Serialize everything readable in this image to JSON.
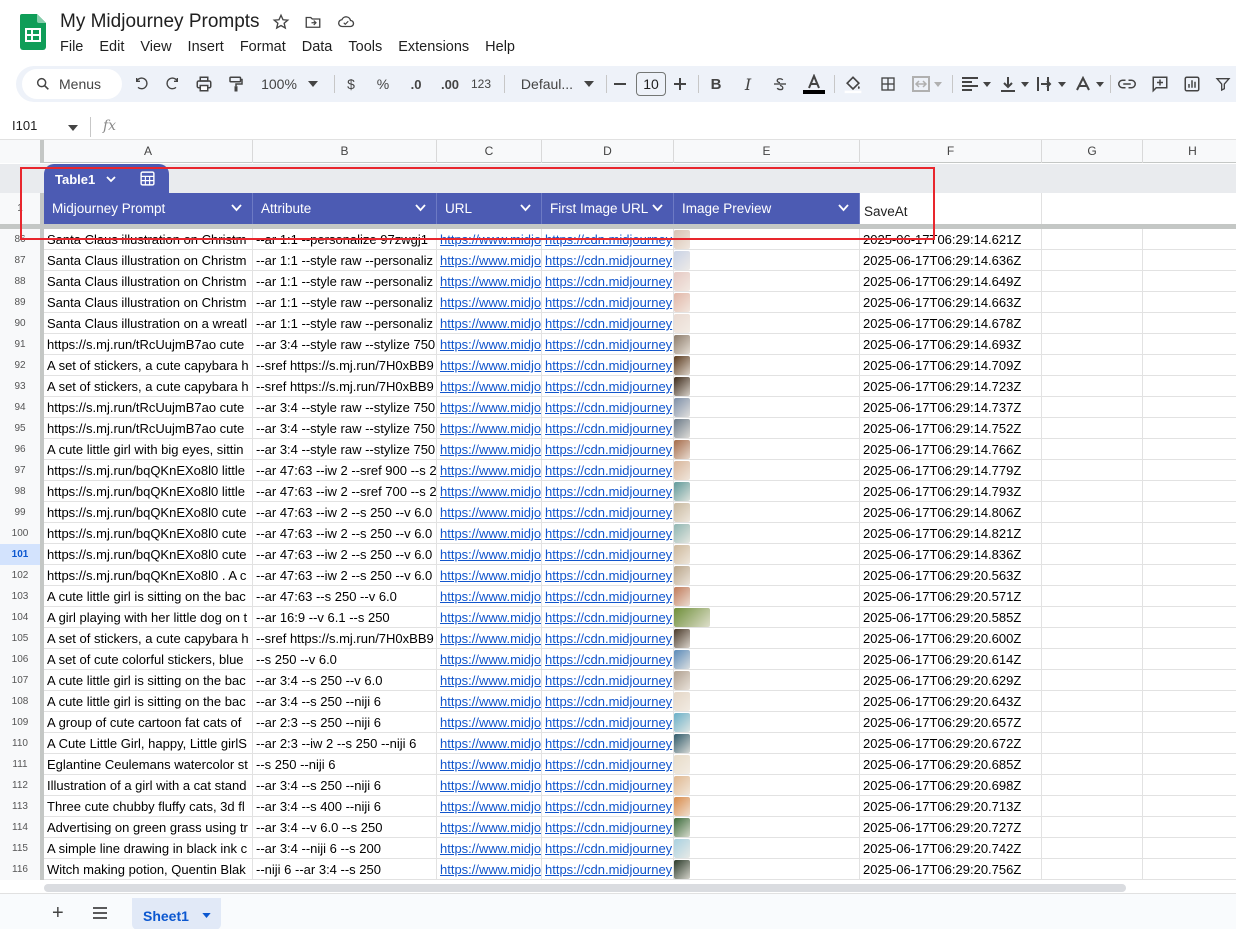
{
  "app": {
    "doc_title": "My Midjourney Prompts",
    "menu": [
      "File",
      "Edit",
      "View",
      "Insert",
      "Format",
      "Data",
      "Tools",
      "Extensions",
      "Help"
    ]
  },
  "toolbar": {
    "search_label": "Menus",
    "zoom": "100%",
    "currency": "$",
    "percent": "%",
    "dec_decrease": ".0",
    "dec_increase": ".00",
    "number_format": "123",
    "font_family": "Defaul...",
    "font_size": "10",
    "bold": "B",
    "italic": "I"
  },
  "formula_bar": {
    "name_box": "I101",
    "fx": "fx"
  },
  "columns": [
    "A",
    "B",
    "C",
    "D",
    "E",
    "F",
    "G",
    "H"
  ],
  "table": {
    "name": "Table1",
    "headers": [
      "Midjourney Prompt",
      "Attribute",
      "URL",
      "First Image URL",
      "Image Preview"
    ],
    "extra_header": "SaveAt",
    "header_row_number": "1"
  },
  "rows": [
    {
      "n": "86",
      "a": "Santa Claus illustration on Christm",
      "b": "--ar 1:1 --personalize 97zwgj1",
      "c": "https://www.midjo",
      "d": "https://cdn.midjourney",
      "f": "2025-06-17T06:29:14.621Z",
      "img": "#d9c2b3"
    },
    {
      "n": "87",
      "a": "Santa Claus illustration on Christm",
      "b": "--ar 1:1 --style raw --personaliz",
      "c": "https://www.midjo",
      "d": "https://cdn.midjourney",
      "f": "2025-06-17T06:29:14.636Z",
      "img": "#c9d2e6"
    },
    {
      "n": "88",
      "a": "Santa Claus illustration on Christm",
      "b": "--ar 1:1 --style raw --personaliz",
      "c": "https://www.midjo",
      "d": "https://cdn.midjourney",
      "f": "2025-06-17T06:29:14.649Z",
      "img": "#e6c9c3"
    },
    {
      "n": "89",
      "a": "Santa Claus illustration on Christm",
      "b": "--ar 1:1 --style raw --personaliz",
      "c": "https://www.midjo",
      "d": "https://cdn.midjourney",
      "f": "2025-06-17T06:29:14.663Z",
      "img": "#e2b7a8"
    },
    {
      "n": "90",
      "a": "Santa Claus illustration on a wreatl",
      "b": "--ar 1:1 --style raw --personaliz",
      "c": "https://www.midjo",
      "d": "https://cdn.midjourney",
      "f": "2025-06-17T06:29:14.678Z",
      "img": "#eadad2"
    },
    {
      "n": "91",
      "a": "https://s.mj.run/tRcUujmB7ao cute",
      "b": "--ar 3:4 --style raw --stylize 750",
      "c": "https://www.midjo",
      "d": "https://cdn.midjourney",
      "f": "2025-06-17T06:29:14.693Z",
      "img": "#8c7b6a"
    },
    {
      "n": "92",
      "a": "A set of stickers, a cute capybara h",
      "b": "--sref https://s.mj.run/7H0xBB9",
      "c": "https://www.midjo",
      "d": "https://cdn.midjourney",
      "f": "2025-06-17T06:29:14.709Z",
      "img": "#5a3a1e"
    },
    {
      "n": "93",
      "a": "A set of stickers, a cute capybara h",
      "b": "--sref https://s.mj.run/7H0xBB9",
      "c": "https://www.midjo",
      "d": "https://cdn.midjourney",
      "f": "2025-06-17T06:29:14.723Z",
      "img": "#3c2a1a"
    },
    {
      "n": "94",
      "a": "https://s.mj.run/tRcUujmB7ao cute",
      "b": "--ar 3:4 --style raw --stylize 750",
      "c": "https://www.midjo",
      "d": "https://cdn.midjourney",
      "f": "2025-06-17T06:29:14.737Z",
      "img": "#7d8fa8"
    },
    {
      "n": "95",
      "a": "https://s.mj.run/tRcUujmB7ao cute",
      "b": "--ar 3:4 --style raw --stylize 750",
      "c": "https://www.midjo",
      "d": "https://cdn.midjourney",
      "f": "2025-06-17T06:29:14.752Z",
      "img": "#6b7a88"
    },
    {
      "n": "96",
      "a": "A cute little girl with big eyes, sittin",
      "b": "--ar 3:4 --style raw --stylize 750",
      "c": "https://www.midjo",
      "d": "https://cdn.midjourney",
      "f": "2025-06-17T06:29:14.766Z",
      "img": "#a56b4a"
    },
    {
      "n": "97",
      "a": "https://s.mj.run/bqQKnEXo8l0 little",
      "b": "--ar 47:63 --iw 2 --sref 900 --s 2",
      "c": "https://www.midjo",
      "d": "https://cdn.midjourney",
      "f": "2025-06-17T06:29:14.779Z",
      "img": "#d8b59a"
    },
    {
      "n": "98",
      "a": "https://s.mj.run/bqQKnEXo8l0 little",
      "b": "--ar 47:63 --iw 2 --sref 700 --s 2",
      "c": "https://www.midjo",
      "d": "https://cdn.midjourney",
      "f": "2025-06-17T06:29:14.793Z",
      "img": "#5f9a9a"
    },
    {
      "n": "99",
      "a": "https://s.mj.run/bqQKnEXo8l0 cute",
      "b": "--ar 47:63 --iw 2 --s 250 --v 6.0",
      "c": "https://www.midjo",
      "d": "https://cdn.midjourney",
      "f": "2025-06-17T06:29:14.806Z",
      "img": "#c9b9a0"
    },
    {
      "n": "100",
      "a": "https://s.mj.run/bqQKnEXo8l0 cute",
      "b": "--ar 47:63 --iw 2 --s 250 --v 6.0",
      "c": "https://www.midjo",
      "d": "https://cdn.midjourney",
      "f": "2025-06-17T06:29:14.821Z",
      "img": "#8fb6b2"
    },
    {
      "n": "101",
      "a": "https://s.mj.run/bqQKnEXo8l0 cute",
      "b": "--ar 47:63 --iw 2 --s 250 --v 6.0",
      "c": "https://www.midjo",
      "d": "https://cdn.midjourney",
      "f": "2025-06-17T06:29:14.836Z",
      "img": "#cdb89b",
      "selected": true
    },
    {
      "n": "102",
      "a": "https://s.mj.run/bqQKnEXo8l0 . A c",
      "b": "--ar 47:63 --iw 2 --s 250 --v 6.0",
      "c": "https://www.midjo",
      "d": "https://cdn.midjourney",
      "f": "2025-06-17T06:29:20.563Z",
      "img": "#b9a58a"
    },
    {
      "n": "103",
      "a": "A cute little girl is sitting on the bac",
      "b": "--ar 47:63 --s 250 --v 6.0",
      "c": "https://www.midjo",
      "d": "https://cdn.midjourney",
      "f": "2025-06-17T06:29:20.571Z",
      "img": "#c07a5a"
    },
    {
      "n": "104",
      "a": "A girl playing with her little dog on t",
      "b": "--ar 16:9 --v 6.1 --s 250",
      "c": "https://www.midjo",
      "d": "https://cdn.midjourney",
      "f": "2025-06-17T06:29:20.585Z",
      "img": "#6f8f3a",
      "wide": true
    },
    {
      "n": "105",
      "a": "A set of stickers, a cute capybara h",
      "b": "--sref https://s.mj.run/7H0xBB9",
      "c": "https://www.midjo",
      "d": "https://cdn.midjourney",
      "f": "2025-06-17T06:29:20.600Z",
      "img": "#4a3a2a"
    },
    {
      "n": "106",
      "a": "A set of cute colorful stickers, blue",
      "b": "--s 250 --v 6.0",
      "c": "https://www.midjo",
      "d": "https://cdn.midjourney",
      "f": "2025-06-17T06:29:20.614Z",
      "img": "#5a8ab8"
    },
    {
      "n": "107",
      "a": "A cute little girl is sitting on the bac",
      "b": "--ar 3:4 --s 250 --v 6.0",
      "c": "https://www.midjo",
      "d": "https://cdn.midjourney",
      "f": "2025-06-17T06:29:20.629Z",
      "img": "#b0a090"
    },
    {
      "n": "108",
      "a": "A cute little girl is sitting on the bac",
      "b": "--ar 3:4 --s 250 --niji 6",
      "c": "https://www.midjo",
      "d": "https://cdn.midjourney",
      "f": "2025-06-17T06:29:20.643Z",
      "img": "#e4d6c6"
    },
    {
      "n": "109",
      "a": "A group of cute cartoon fat cats of",
      "b": "--ar 2:3 --s 250 --niji 6",
      "c": "https://www.midjo",
      "d": "https://cdn.midjourney",
      "f": "2025-06-17T06:29:20.657Z",
      "img": "#6ab0c8"
    },
    {
      "n": "110",
      "a": "A Cute Little Girl, happy, Little girlS",
      "b": "--ar 2:3 --iw 2 --s 250 --niji 6",
      "c": "https://www.midjo",
      "d": "https://cdn.midjourney",
      "f": "2025-06-17T06:29:20.672Z",
      "img": "#2f5a6a"
    },
    {
      "n": "111",
      "a": "Eglantine Ceulemans watercolor st",
      "b": "--s 250 --niji 6",
      "c": "https://www.midjo",
      "d": "https://cdn.midjourney",
      "f": "2025-06-17T06:29:20.685Z",
      "img": "#e8dcc8"
    },
    {
      "n": "112",
      "a": "Illustration of a girl with a cat stand",
      "b": "--ar 3:4 --s 250 --niji 6",
      "c": "https://www.midjo",
      "d": "https://cdn.midjourney",
      "f": "2025-06-17T06:29:20.698Z",
      "img": "#e0b890"
    },
    {
      "n": "113",
      "a": "Three cute chubby fluffy cats, 3d fl",
      "b": "--ar 3:4 --s 400 --niji 6",
      "c": "https://www.midjo",
      "d": "https://cdn.midjourney",
      "f": "2025-06-17T06:29:20.713Z",
      "img": "#d88a4a"
    },
    {
      "n": "114",
      "a": "Advertising on green grass using tr",
      "b": "--ar 3:4 --v 6.0 --s 250",
      "c": "https://www.midjo",
      "d": "https://cdn.midjourney",
      "f": "2025-06-17T06:29:20.727Z",
      "img": "#3a6a3a"
    },
    {
      "n": "115",
      "a": "A simple line drawing in black ink c",
      "b": "--ar 3:4 --niji 6 --s 200",
      "c": "https://www.midjo",
      "d": "https://cdn.midjourney",
      "f": "2025-06-17T06:29:20.742Z",
      "img": "#a8d0e0"
    },
    {
      "n": "116",
      "a": "Witch making potion, Quentin Blak",
      "b": "--niji 6 --ar 3:4 --s 250",
      "c": "https://www.midjo",
      "d": "https://cdn.midjourney",
      "f": "2025-06-17T06:29:20.756Z",
      "img": "#2a3a2a"
    }
  ],
  "sheetbar": {
    "add": "+",
    "sheet_tab": "Sheet1"
  }
}
